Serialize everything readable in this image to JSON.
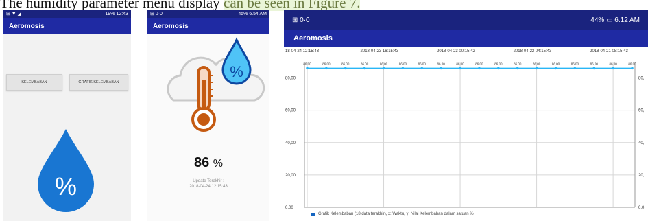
{
  "caption": {
    "prefix": "The humidity parameter menu display",
    "highlight": "can be seen in Figure 7."
  },
  "phone1": {
    "status_left": "⊞ ▼ ◢",
    "status_right": "19% 12:43",
    "app_title": "Aeromosis",
    "btn_humidity": "KELEMBABAN",
    "btn_graph": "GRAFIK KELEMBABAN",
    "drop_symbol": "%"
  },
  "phone2": {
    "status_left": "⊞ 0·0",
    "status_right": "45% 6.54 AM",
    "app_title": "Aeromosis",
    "humidity_value": "86",
    "humidity_unit": "%",
    "update_label": "Update Terakhir :",
    "update_time": "2018-04-24 12:15:43",
    "drop_symbol": "%"
  },
  "phone3": {
    "status_left": "⊞ 0·0",
    "status_right": "44% ▭ 6.12 AM",
    "app_title": "Aeromosis",
    "legend": "Grafik Kelembaban (18 data terakhir),  x: Waktu,  y: Nilai Kelembaban dalam satuan %"
  },
  "chart_data": {
    "type": "line",
    "x": [
      "18-04-24 12:15:43",
      "",
      "",
      "",
      "2018-04-23 16:15:43",
      "",
      "",
      "",
      "2018-04-23 00:15:42",
      "",
      "",
      "",
      "2018-04-22 04:15:43",
      "",
      "",
      "",
      "2018-04-21 08:15:43",
      ""
    ],
    "top_tick_labels": [
      "18-04-24 12:15:43",
      "2018-04-23 16:15:43",
      "2018-04-23 00:15:42",
      "2018-04-22 04:15:43",
      "2018-04-21 08:15:43"
    ],
    "series": [
      {
        "values": [
          86,
          86,
          86,
          86,
          86,
          86,
          86,
          86,
          86,
          86,
          86,
          86,
          86,
          86,
          86,
          86,
          86,
          86
        ]
      }
    ],
    "point_labels": [
      "86,00",
      "86,00",
      "86,00",
      "86,00",
      "86,00",
      "86,00",
      "86,00",
      "86,00",
      "86,00",
      "86,00",
      "86,00",
      "86,00",
      "86,00",
      "86,00",
      "86,00",
      "86,00",
      "86,00",
      "86,00"
    ],
    "y_ticks": [
      "0,00",
      "20,00",
      "40,00",
      "60,00",
      "80,00"
    ],
    "right_y_ticks": [
      "0,0",
      "20,",
      "40,",
      "60,",
      "80,"
    ],
    "ylim": [
      0,
      90
    ],
    "grid": true,
    "line_color": "#29b6f6"
  }
}
